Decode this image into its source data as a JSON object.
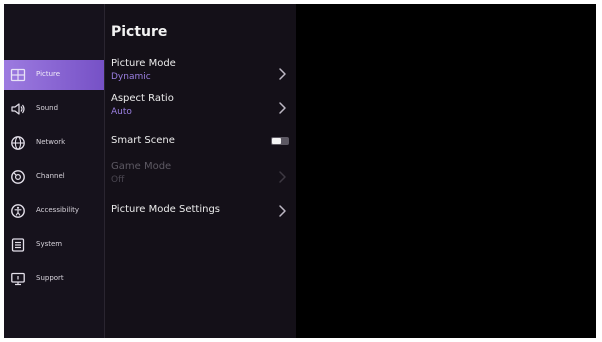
{
  "page": {
    "title": "Picture"
  },
  "sidebar": {
    "items": [
      {
        "label": "Picture",
        "icon": "picture-icon",
        "active": true
      },
      {
        "label": "Sound",
        "icon": "speaker-icon"
      },
      {
        "label": "Network",
        "icon": "globe-icon"
      },
      {
        "label": "Channel",
        "icon": "channel-icon"
      },
      {
        "label": "Accessibility",
        "icon": "accessibility-icon"
      },
      {
        "label": "System",
        "icon": "system-icon"
      },
      {
        "label": "Support",
        "icon": "support-icon"
      }
    ]
  },
  "settings": {
    "picture_mode": {
      "label": "Picture Mode",
      "value": "Dynamic"
    },
    "aspect_ratio": {
      "label": "Aspect Ratio",
      "value": "Auto"
    },
    "smart_scene": {
      "label": "Smart Scene",
      "enabled": false
    },
    "game_mode": {
      "label": "Game Mode",
      "value": "Off",
      "disabled": true
    },
    "picture_mode_settings": {
      "label": "Picture Mode Settings"
    }
  },
  "colors": {
    "accent": "#8b68d8",
    "value_text": "#9a7fe0",
    "panel_bg": "#141018",
    "screen_bg": "#000000"
  }
}
